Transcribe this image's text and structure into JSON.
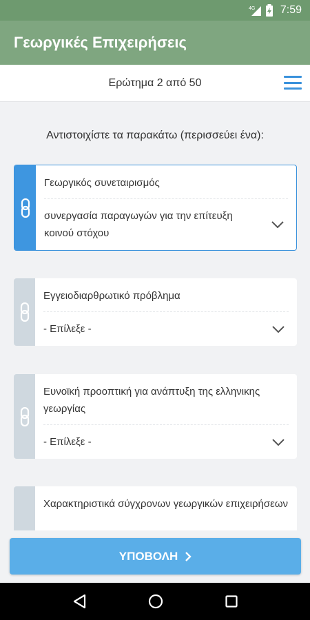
{
  "status_bar": {
    "network": "4G",
    "time": "7:59"
  },
  "app": {
    "title": "Γεωργικές Επιχειρήσεις"
  },
  "question": {
    "counter": "Ερώτημα 2 από 50",
    "instruction": "Αντιστοιχίστε τα παρακάτω (περισσεύει ένα):"
  },
  "items": [
    {
      "label": "Γεωργικός συνεταιρισμός",
      "selected": "συνεργασία παραγωγών για την επίτευξη κοινού στόχου"
    },
    {
      "label": "Εγγειοδιαρθρωτικό πρόβλημα",
      "selected": "- Επίλεξε -"
    },
    {
      "label": "Ευνοϊκή προοπτική για ανάπτυξη της ελληνικης γεωργίας",
      "selected": "- Επίλεξε -"
    },
    {
      "label": "Χαρακτηριστικά σύγχρονων γεωργικών επιχειρήσεων"
    }
  ],
  "submit": {
    "label": "ΥΠΟΒΟΛΗ"
  },
  "colors": {
    "app_bar": "#7fa680",
    "status_bar": "#6e9a6f",
    "accent": "#3a92dc",
    "submit": "#5aaee8"
  },
  "icons": [
    "link-icon",
    "chevron-down-icon",
    "menu-icon",
    "back-icon",
    "home-icon",
    "recents-icon",
    "battery-icon",
    "signal-icon"
  ]
}
